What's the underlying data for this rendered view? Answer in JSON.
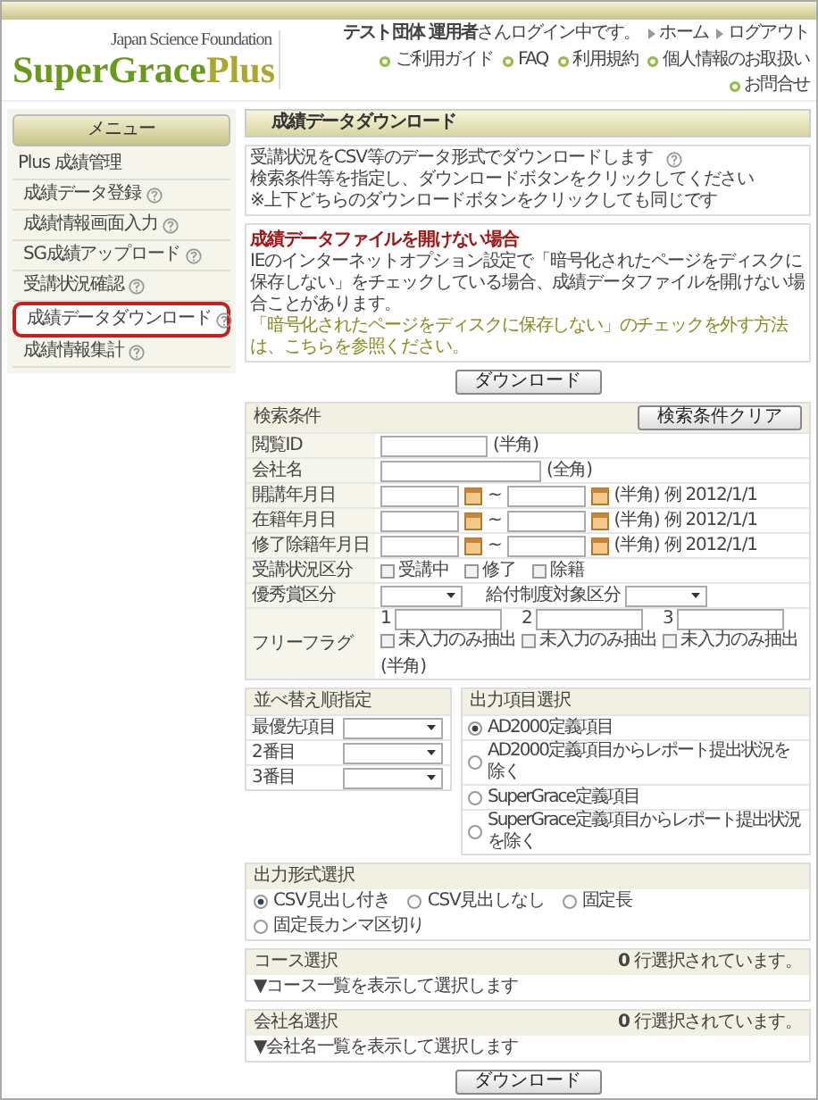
{
  "header": {
    "org": "Japan Science Foundation",
    "logo": "SuperGrace",
    "logo_accent": "Plus",
    "user_org": "テスト団体",
    "user_name": "運用者",
    "user_suffix": "さんログイン中です。",
    "nav_links": [
      "ホーム",
      "ログアウト"
    ],
    "help_links": [
      "ご利用ガイド",
      "FAQ",
      "利用規約",
      "個人情報のお取扱い",
      "お問合せ"
    ]
  },
  "sidebar": {
    "title": "メニュー",
    "group": "Plus 成績管理",
    "items": [
      {
        "label": "成績データ登録",
        "selected": false
      },
      {
        "label": "成績情報画面入力",
        "selected": false
      },
      {
        "label": "SG成績アップロード",
        "selected": false
      },
      {
        "label": "受講状況確認",
        "selected": false
      },
      {
        "label": "成績データダウンロード",
        "selected": true
      },
      {
        "label": "成績情報集計",
        "selected": false
      }
    ]
  },
  "main": {
    "title": "成績データダウンロード",
    "intro": [
      "受講状況をCSV等のデータ形式でダウンロードします",
      "検索条件等を指定し、ダウンロードボタンをクリックしてください"
    ],
    "note": "※上下どちらのダウンロードボタンをクリックしても同じです",
    "warning_title": "成績データファイルを開けない場合",
    "warning_text": "IEのインターネットオプション設定で「暗号化されたページをディスクに保存しない」をチェックしている場合、成績データファイルを開けない場合ことがあります。",
    "warning_link": "「暗号化されたページをディスクに保存しない」のチェックを外す方法は、こちらを参照ください。",
    "download_button": "ダウンロード"
  },
  "search": {
    "title": "検索条件",
    "clear_button": "検索条件クリア",
    "rows": [
      {
        "kind": "text",
        "label": "閲覧ID",
        "hint": "(半角)"
      },
      {
        "kind": "wide-text",
        "label": "会社名",
        "hint": "(全角)"
      },
      {
        "kind": "date-range",
        "label": "開講年月日",
        "separator": "~",
        "hint": "(半角) 例 2012/1/1"
      },
      {
        "kind": "date-range",
        "label": "在籍年月日",
        "separator": "~",
        "hint": "(半角) 例 2012/1/1"
      },
      {
        "kind": "date-range",
        "label": "修了除籍年月日",
        "separator": "~",
        "hint": "(半角) 例 2012/1/1"
      },
      {
        "kind": "checks",
        "label": "受講状況区分",
        "options": [
          {
            "label": "受講中",
            "checked": false
          },
          {
            "label": "修了",
            "checked": false
          },
          {
            "label": "除籍",
            "checked": false
          }
        ]
      },
      {
        "kind": "selects",
        "label": "優秀賞区分",
        "second_label": "給付制度対象区分"
      },
      {
        "kind": "flags",
        "label": "フリーフラグ",
        "hint": "(半角)",
        "flags": [
          {
            "number": "1",
            "option": "未入力のみ抽出",
            "checked": false
          },
          {
            "number": "2",
            "option": "未入力のみ抽出",
            "checked": false
          },
          {
            "number": "3",
            "option": "未入力のみ抽出",
            "checked": false
          }
        ]
      }
    ]
  },
  "sort": {
    "title": "並べ替え順指定",
    "rows": [
      "最優先項目",
      "2番目",
      "3番目"
    ]
  },
  "output_items": {
    "title": "出力項目選択",
    "options": [
      {
        "label": "AD2000定義項目",
        "selected": true
      },
      {
        "label": "AD2000定義項目からレポート提出状況を除く",
        "selected": false
      },
      {
        "label": "SuperGrace定義項目",
        "selected": false
      },
      {
        "label": "SuperGrace定義項目からレポート提出状況を除く",
        "selected": false
      }
    ]
  },
  "format": {
    "title": "出力形式選択",
    "options": [
      {
        "label": "CSV見出し付き",
        "selected": true
      },
      {
        "label": "CSV見出しなし",
        "selected": false
      },
      {
        "label": "固定長",
        "selected": false
      },
      {
        "label": "固定長カンマ区切り",
        "selected": false
      }
    ]
  },
  "selections": [
    {
      "title": "コース選択",
      "count": "0",
      "count_suffix": "行選択されています。",
      "toggle": "▼コース一覧を表示して選択します"
    },
    {
      "title": "会社名選択",
      "count": "0",
      "count_suffix": "行選択されています。",
      "toggle": "▼会社名一覧を表示して選択します"
    }
  ],
  "bottom_button": "ダウンロード"
}
